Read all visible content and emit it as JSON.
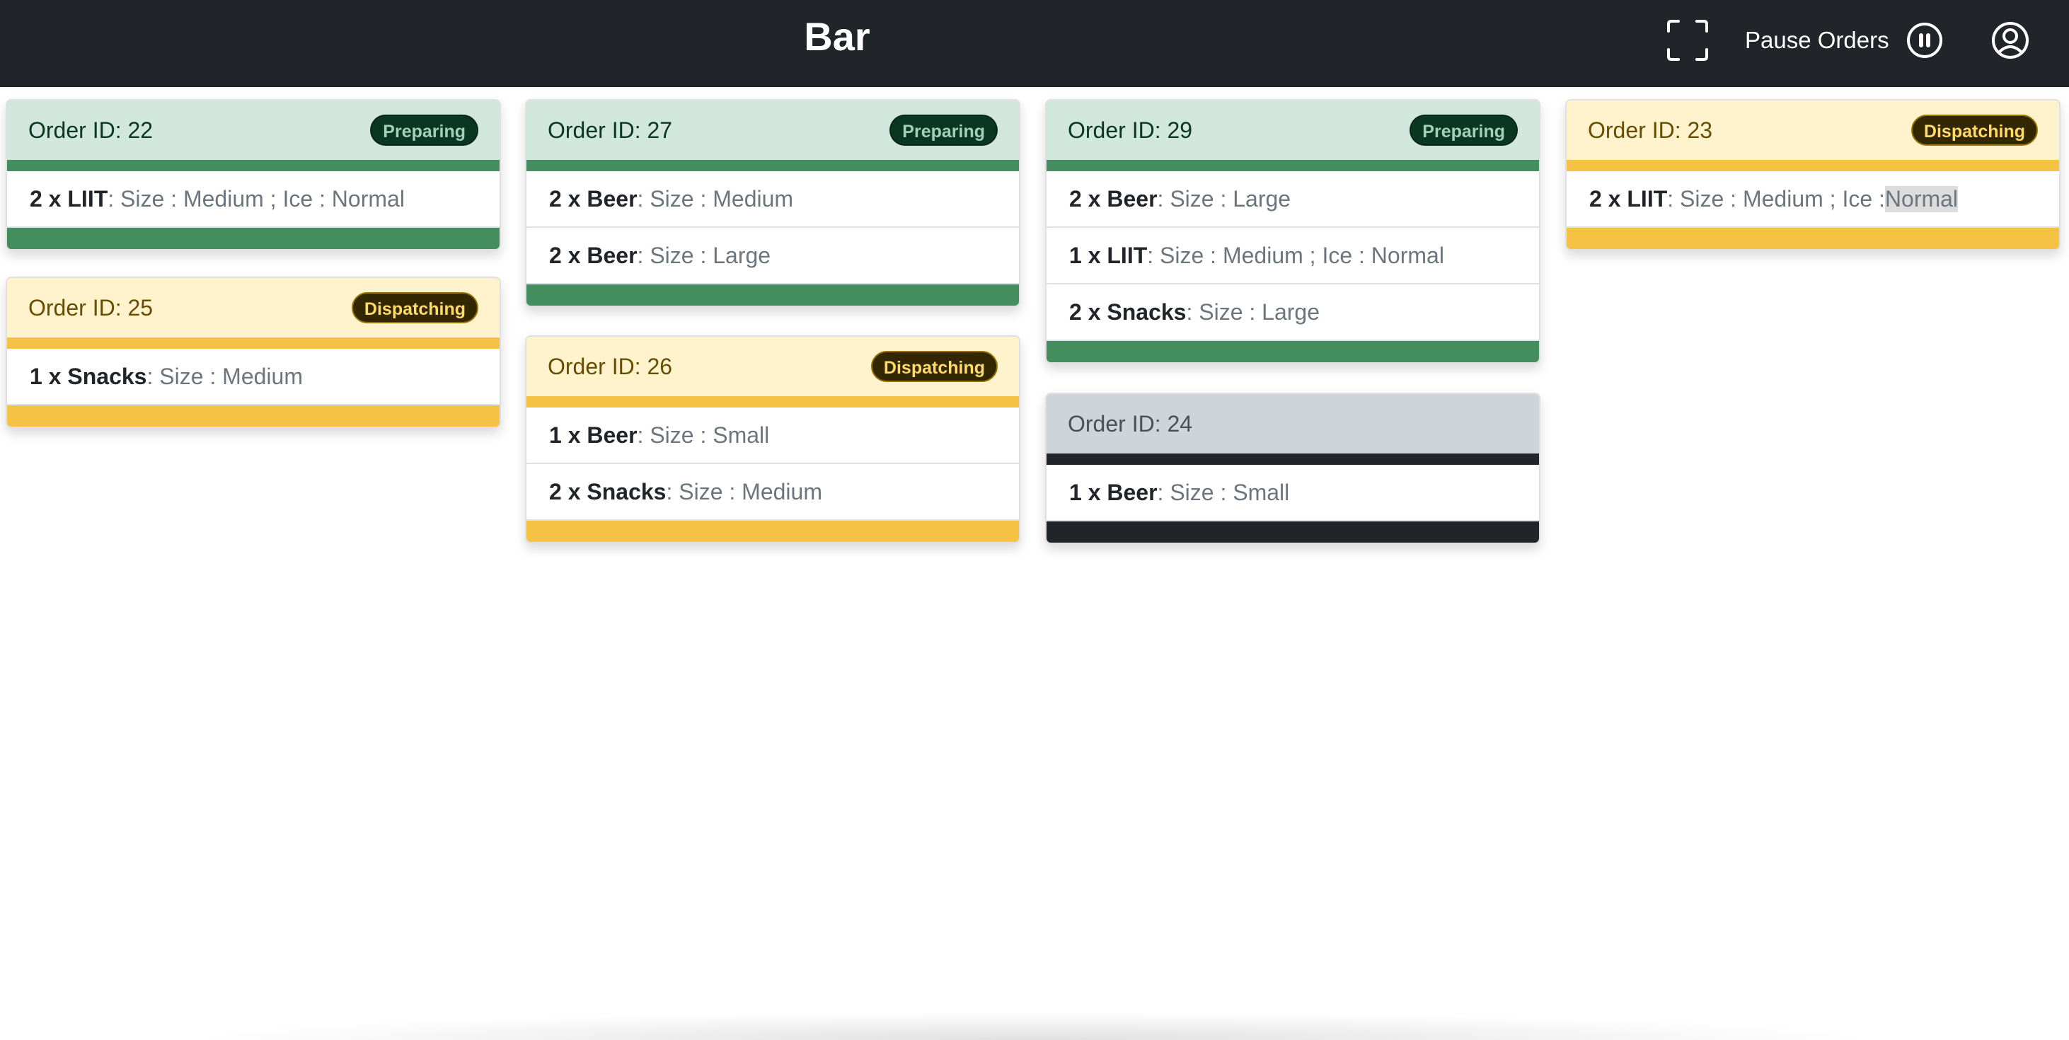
{
  "header": {
    "title": "Bar",
    "pause_label": "Pause Orders",
    "icons": {
      "fullscreen": "fullscreen-icon",
      "pause": "pause-circle-icon",
      "account": "account-circle-icon"
    }
  },
  "colors": {
    "navbar": "#212529",
    "preparing_header": "#d1e7dd",
    "preparing_bar": "#438d5e",
    "dispatching_header": "#fff3cd",
    "dispatching_bar": "#f6c244",
    "idle_header": "#ced4da",
    "idle_bar": "#212529"
  },
  "orders": [
    {
      "id_label": "Order ID: 22",
      "status": "Preparing",
      "items": [
        {
          "name": "2 x LIIT",
          "details": ": Size : Medium ; Ice : Normal"
        }
      ]
    },
    {
      "id_label": "Order ID: 25",
      "status": "Dispatching",
      "items": [
        {
          "name": "1 x Snacks",
          "details": ": Size : Medium"
        }
      ]
    },
    {
      "id_label": "Order ID: 27",
      "status": "Preparing",
      "items": [
        {
          "name": "2 x Beer",
          "details": ": Size : Medium"
        },
        {
          "name": "2 x Beer",
          "details": ": Size : Large"
        }
      ]
    },
    {
      "id_label": "Order ID: 26",
      "status": "Dispatching",
      "items": [
        {
          "name": "1 x Beer",
          "details": ": Size : Small"
        },
        {
          "name": "2 x Snacks",
          "details": ": Size : Medium"
        }
      ]
    },
    {
      "id_label": "Order ID: 29",
      "status": "Preparing",
      "items": [
        {
          "name": "2 x Beer",
          "details": ": Size : Large"
        },
        {
          "name": "1 x LIIT",
          "details": ": Size : Medium ; Ice : Normal"
        },
        {
          "name": "2 x Snacks",
          "details": ": Size : Large"
        }
      ]
    },
    {
      "id_label": "Order ID: 24",
      "status": "",
      "items": [
        {
          "name": "1 x Beer",
          "details": ": Size : Small"
        }
      ]
    },
    {
      "id_label": "Order ID: 23",
      "status": "Dispatching",
      "items": [
        {
          "name": "2 x LIIT",
          "details_prefix": ": Size : Medium ; Ice : ",
          "details_highlight": "Normal"
        }
      ]
    }
  ]
}
